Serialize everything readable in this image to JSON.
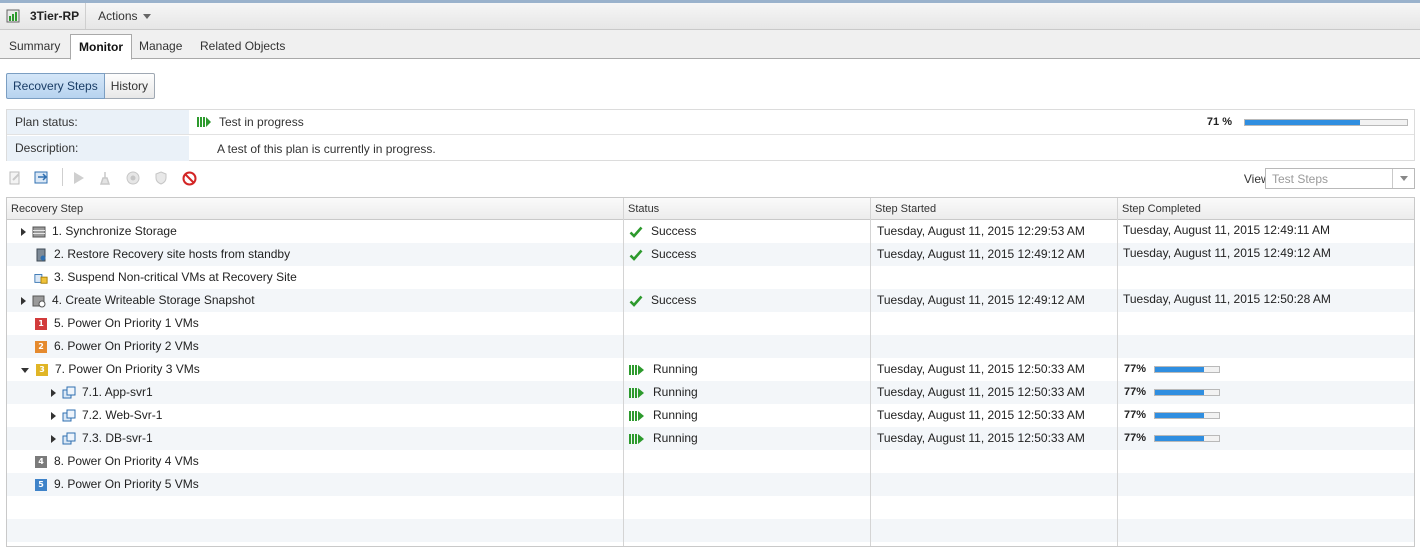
{
  "title_bar": {
    "object_name": "3Tier-RP",
    "actions_label": "Actions"
  },
  "tabs": [
    {
      "label": "Summary"
    },
    {
      "label": "Monitor"
    },
    {
      "label": "Manage"
    },
    {
      "label": "Related Objects"
    }
  ],
  "subtabs": [
    {
      "label": "Recovery Steps"
    },
    {
      "label": "History"
    }
  ],
  "plan": {
    "status_label": "Plan status:",
    "status_value": "Test in progress",
    "progress_text": "71 %",
    "progress": 71,
    "description_label": "Description:",
    "description_value": "A test of this plan is currently in progress."
  },
  "toolbar": {
    "view_label": "View:",
    "view_value": "Test Steps"
  },
  "grid": {
    "headers": [
      "Recovery Step",
      "Status",
      "Step Started",
      "Step Completed"
    ],
    "rows": [
      {
        "step": "1. Synchronize Storage",
        "status": "Success",
        "started": "Tuesday, August 11, 2015 12:29:53 AM",
        "completed": "Tuesday, August 11, 2015 12:49:11 AM"
      },
      {
        "step": "2. Restore Recovery site hosts from standby",
        "status": "Success",
        "started": "Tuesday, August 11, 2015 12:49:12 AM",
        "completed": "Tuesday, August 11, 2015 12:49:12 AM"
      },
      {
        "step": "3. Suspend Non-critical VMs at Recovery Site",
        "status": "",
        "started": "",
        "completed": ""
      },
      {
        "step": "4. Create Writeable Storage Snapshot",
        "status": "Success",
        "started": "Tuesday, August 11, 2015 12:49:12 AM",
        "completed": "Tuesday, August 11, 2015 12:50:28 AM"
      },
      {
        "step": "5. Power On Priority 1 VMs",
        "priority": "1",
        "status": "",
        "started": "",
        "completed": ""
      },
      {
        "step": "6. Power On Priority 2 VMs",
        "priority": "2",
        "status": "",
        "started": "",
        "completed": ""
      },
      {
        "step": "7. Power On Priority 3 VMs",
        "priority": "3",
        "status": "Running",
        "started": "Tuesday, August 11, 2015 12:50:33 AM",
        "completed_pct": "77%",
        "progress": 77
      },
      {
        "step": "7.1. App-svr1",
        "status": "Running",
        "started": "Tuesday, August 11, 2015 12:50:33 AM",
        "completed_pct": "77%",
        "progress": 77
      },
      {
        "step": "7.2. Web-Svr-1",
        "status": "Running",
        "started": "Tuesday, August 11, 2015 12:50:33 AM",
        "completed_pct": "77%",
        "progress": 77
      },
      {
        "step": "7.3. DB-svr-1",
        "status": "Running",
        "started": "Tuesday, August 11, 2015 12:50:33 AM",
        "completed_pct": "77%",
        "progress": 77
      },
      {
        "step": "8. Power On Priority 4 VMs",
        "priority": "4",
        "status": "",
        "started": "",
        "completed": ""
      },
      {
        "step": "9. Power On Priority 5 VMs",
        "priority": "5",
        "status": "",
        "started": "",
        "completed": ""
      }
    ]
  }
}
